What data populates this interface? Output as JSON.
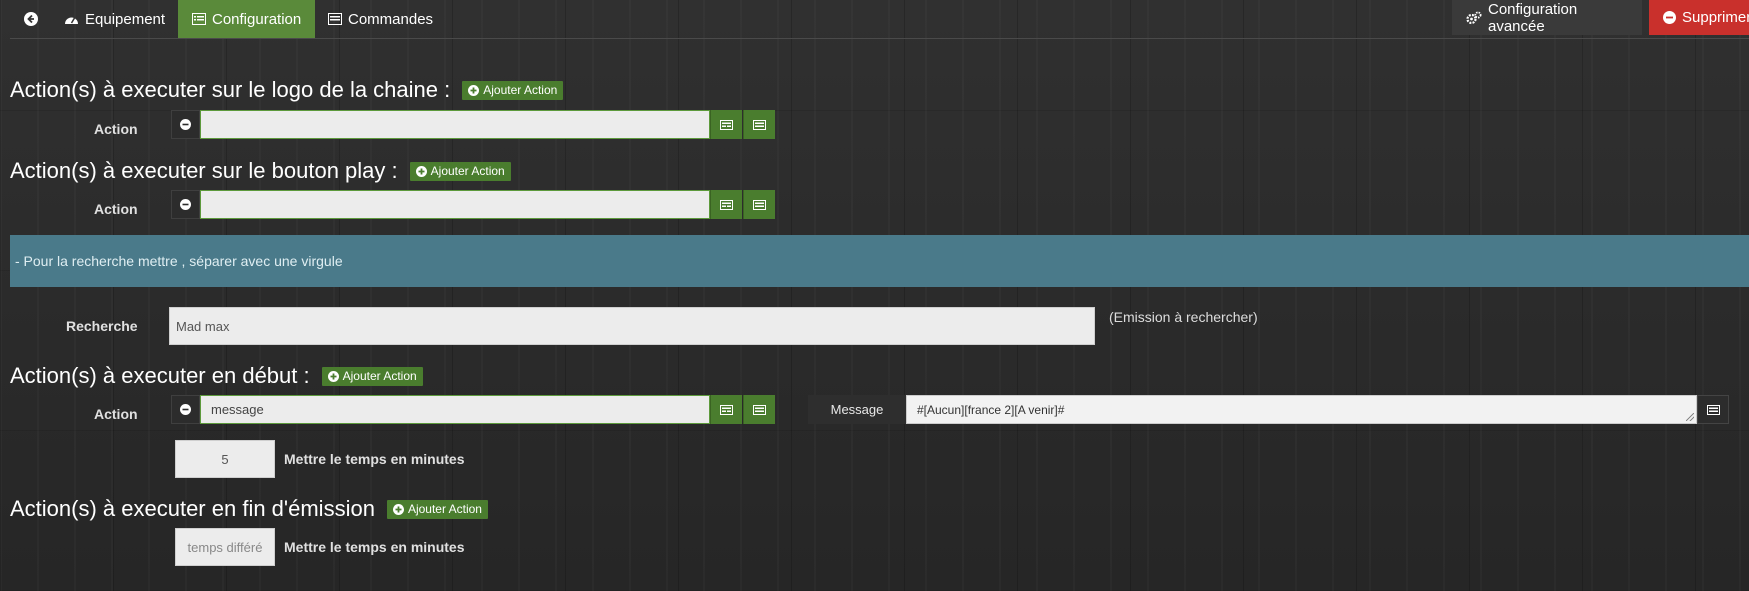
{
  "nav": {
    "back_icon": "arrow-circle-left-icon",
    "tabs": [
      {
        "label": "Equipement",
        "icon": "dashboard-icon"
      },
      {
        "label": "Configuration",
        "icon": "list-alt-icon"
      },
      {
        "label": "Commandes",
        "icon": "list-icon"
      }
    ],
    "advanced_label": "Configuration avancée",
    "delete_label": "Supprimer"
  },
  "sections": {
    "logo": {
      "title": "Action(s) à executer sur le logo de la chaine :",
      "add_label": "Ajouter Action",
      "action_label": "Action",
      "action_value": ""
    },
    "play": {
      "title": "Action(s) à executer sur le bouton play :",
      "add_label": "Ajouter Action",
      "action_label": "Action",
      "action_value": ""
    },
    "start": {
      "title": "Action(s) à executer en début :",
      "add_label": "Ajouter Action",
      "action_label": "Action",
      "action_value": "message",
      "message_label": "Message",
      "message_value": "#[Aucun][france 2][A venir]#",
      "minutes_value": "5",
      "minutes_label": "Mettre le temps en minutes"
    },
    "end": {
      "title": "Action(s) à executer en fin d'émission",
      "add_label": "Ajouter Action",
      "delay_placeholder": "temps différé",
      "minutes_label": "Mettre le temps en minutes"
    }
  },
  "info": {
    "text": "- Pour la recherche mettre , séparer avec une virgule"
  },
  "search": {
    "label": "Recherche",
    "value": "Mad max",
    "hint": "(Emission à rechercher)"
  },
  "colors": {
    "active_tab": "#5a8a3a",
    "add_button": "#4a7d2e",
    "delete": "#c9302c",
    "info_band": "#4a7a8a"
  }
}
